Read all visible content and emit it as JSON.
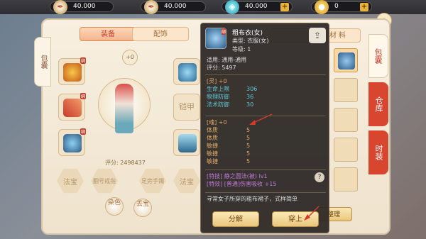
{
  "resources": [
    {
      "icon": "quill-icon",
      "value": "40.000"
    },
    {
      "icon": "quill-icon",
      "value": "40.000"
    },
    {
      "icon": "ticket-icon",
      "value": "40.000"
    },
    {
      "icon": "gold-coin-icon",
      "value": "0"
    }
  ],
  "left_tab": "包囊",
  "tabs": {
    "equip": "装备",
    "accessory": "配饰"
  },
  "level_plus": "+0",
  "score_label": "评分: 2498437",
  "slot_badge": "绑",
  "hex_slots": [
    "法宝",
    "翻号戒指",
    "足旁手镯",
    "法宝"
  ],
  "gem_slots": [
    "染色",
    "丢宝"
  ],
  "side_label": "铠甲",
  "popup": {
    "name": "粗布衣(女)",
    "type": "类型: 衣服(女)",
    "level": "等级: 1",
    "fit": "适用: 通用-通用",
    "score": "评分: 5497",
    "ling_title": "[灵] +0",
    "stats": [
      {
        "k": "生命上限",
        "v": "306"
      },
      {
        "k": "物理防御",
        "v": "36"
      },
      {
        "k": "法术防御",
        "v": "30"
      }
    ],
    "hun_title": "[魂] +0",
    "hun": [
      {
        "k": "体质",
        "v": "5"
      },
      {
        "k": "体质",
        "v": "5"
      },
      {
        "k": "敏捷",
        "v": "5"
      },
      {
        "k": "敏捷",
        "v": "5"
      },
      {
        "k": "敏捷",
        "v": "5"
      }
    ],
    "skill": "[特技] 静之圆法(被) lv1",
    "effect": "[特效] [普通]伤害吸收 +15",
    "desc": "寻常女子所穿的粗布裙子，式样简单",
    "btn_decompose": "分解",
    "btn_wear": "穿上",
    "help": "?"
  },
  "right_header": "材 料",
  "sort_btn": "整理",
  "right_tabs": [
    "包囊",
    "仓库",
    "时装"
  ],
  "colors": {
    "accent": "#e26b3a",
    "stat_blue": "#5fc7d6",
    "skill_purple": "#c27ad9"
  }
}
